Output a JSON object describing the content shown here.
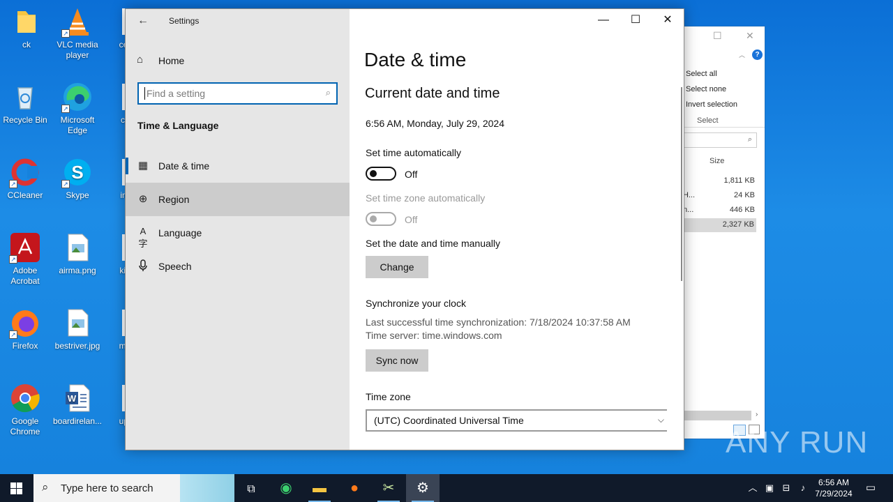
{
  "desktop": {
    "icons": [
      {
        "label": "ck"
      },
      {
        "label": "VLC media player"
      },
      {
        "label": "certa"
      },
      {
        "label": "Recycle Bin"
      },
      {
        "label": "Microsoft Edge"
      },
      {
        "label": "cool"
      },
      {
        "label": "CCleaner"
      },
      {
        "label": "Skype"
      },
      {
        "label": "inter"
      },
      {
        "label": "Adobe Acrobat"
      },
      {
        "label": "airma.png"
      },
      {
        "label": "kidsr"
      },
      {
        "label": "Firefox"
      },
      {
        "label": "bestriver.jpg"
      },
      {
        "label": "mont"
      },
      {
        "label": "Google Chrome"
      },
      {
        "label": "boardirelan..."
      },
      {
        "label": "upda"
      }
    ]
  },
  "explorer": {
    "menu": [
      "Select all",
      "Select none",
      "Invert selection"
    ],
    "group_label": "Select",
    "column_size": "Size",
    "rows": [
      {
        "name": "",
        "size": "1,811 KB"
      },
      {
        "name": "H...",
        "size": "24 KB"
      },
      {
        "name": "n...",
        "size": "446 KB"
      },
      {
        "name": "",
        "size": "2,327 KB"
      }
    ]
  },
  "settings": {
    "window_title": "Settings",
    "sidebar": {
      "home_label": "Home",
      "search_placeholder": "Find a setting",
      "section_heading": "Time & Language",
      "items": [
        {
          "label": "Date & time",
          "icon": "calendar-clock-icon"
        },
        {
          "label": "Region",
          "icon": "globe-icon"
        },
        {
          "label": "Language",
          "icon": "language-icon"
        },
        {
          "label": "Speech",
          "icon": "microphone-icon"
        }
      ]
    },
    "page": {
      "title": "Date & time",
      "subtitle": "Current date and time",
      "current_datetime": "6:56 AM, Monday, July 29, 2024",
      "set_time_auto_label": "Set time automatically",
      "set_time_auto_state": "Off",
      "set_tz_auto_label": "Set time zone automatically",
      "set_tz_auto_state": "Off",
      "manual_label": "Set the date and time manually",
      "change_button": "Change",
      "sync_heading": "Synchronize your clock",
      "last_sync": "Last successful time synchronization: 7/18/2024 10:37:58 AM",
      "time_server": "Time server: time.windows.com",
      "sync_button": "Sync now",
      "timezone_label": "Time zone",
      "timezone_value": "(UTC) Coordinated Universal Time"
    }
  },
  "taskbar": {
    "search_placeholder": "Type here to search",
    "time": "6:56 AM",
    "date": "7/29/2024"
  },
  "watermark": "ANY RUN"
}
